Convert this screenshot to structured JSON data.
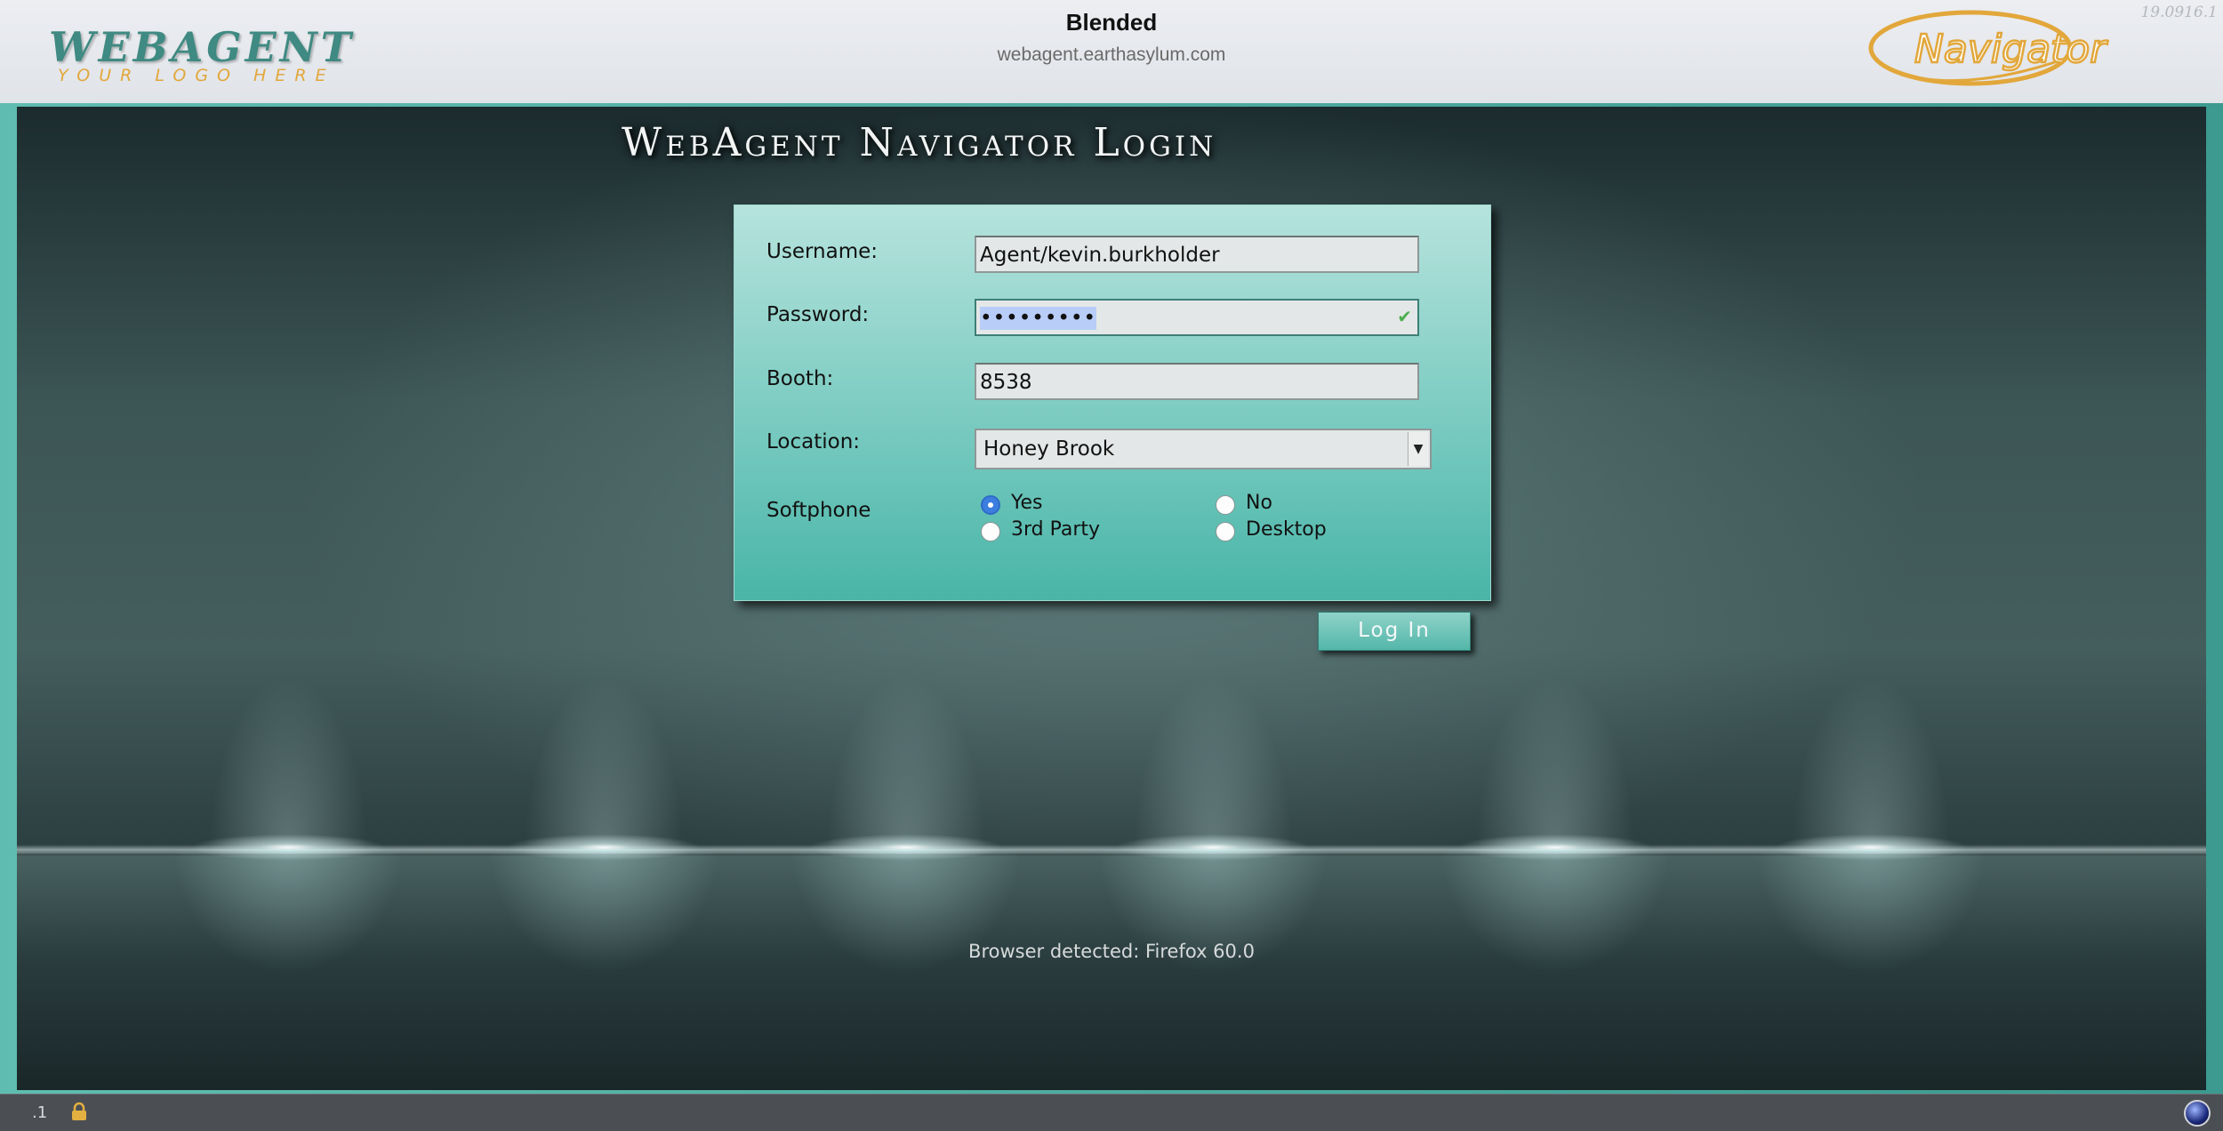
{
  "header": {
    "logo_brand": "WEBAGENT",
    "logo_tagline": "YOUR LOGO HERE",
    "campaign": "Blended",
    "host": "webagent.earthasylum.com",
    "version": "19.0916.1",
    "navigator_logo": "Navigator"
  },
  "login": {
    "title": "WebAgent Navigator Login",
    "username_label": "Username:",
    "username_value": "Agent/kevin.burkholder",
    "password_label": "Password:",
    "password_value": "•••••••••",
    "booth_label": "Booth:",
    "booth_value": "8538",
    "location_label": "Location:",
    "location_value": "Honey Brook",
    "softphone_label": "Softphone",
    "softphone_options": [
      "Yes",
      "No",
      "3rd Party",
      "Desktop"
    ],
    "softphone_selected": "Yes",
    "login_button": "Log In"
  },
  "footer": {
    "browser_detected": "Browser detected: Firefox 60.0",
    "status_text": ".1"
  },
  "colors": {
    "accent": "#4fb3a6",
    "logo_gold": "#e2a73b",
    "radio_selected": "#3b7ee0"
  }
}
